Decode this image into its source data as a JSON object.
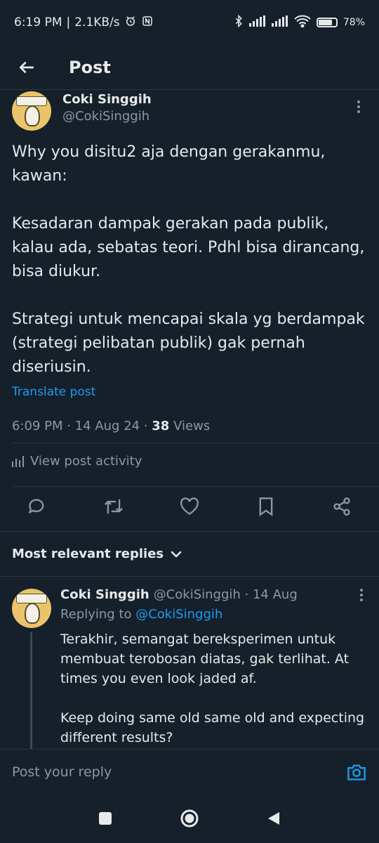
{
  "status_bar": {
    "time": "6:19 PM",
    "speed": "2.1KB/s",
    "battery": "78",
    "battery_percent": 78,
    "icons": [
      "alarm-icon",
      "nfc-icon",
      "bluetooth-icon",
      "signal-icon",
      "signal-icon",
      "wifi-icon",
      "battery-icon"
    ]
  },
  "header": {
    "title": "Post"
  },
  "tweet": {
    "author_name": "Coki Singgih",
    "author_handle": "@CokiSinggih",
    "text": "Why you disitu2 aja dengan gerakanmu, kawan:\n\nKesadaran dampak gerakan pada publik, kalau ada, sebatas teori. Pdhl bisa dirancang, bisa diukur.\n\nStrategi untuk mencapai skala yg berdampak (strategi pelibatan publik) gak pernah diseriusin.",
    "translate_label": "Translate post",
    "time": "6:09 PM",
    "date": "14 Aug 24",
    "views_count": "38",
    "views_label": "Views",
    "activity_label": "View post activity"
  },
  "section": {
    "label": "Most relevant replies"
  },
  "reply": {
    "author_name": "Coki Singgih",
    "author_handle": "@CokiSinggih",
    "date": "14 Aug",
    "replying_prefix": "Replying to",
    "replying_to": "@CokiSinggih",
    "text": "Terakhir, semangat bereksperimen untuk membuat terobosan diatas, gak terlihat. At times you even look jaded af.\n\nKeep doing same old same old and expecting different results?"
  },
  "compose": {
    "placeholder": "Post your reply"
  },
  "colors": {
    "background": "#15202b",
    "accent": "#1d9bf0",
    "text": "#e7e9ea",
    "muted": "#8b98a5"
  }
}
